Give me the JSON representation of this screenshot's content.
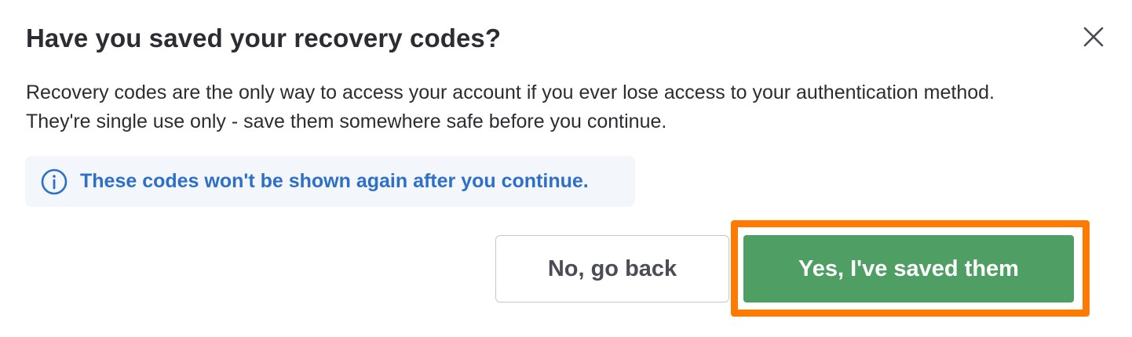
{
  "dialog": {
    "title": "Have you saved your recovery codes?",
    "close_icon": "close-icon",
    "body_line_1": "Recovery codes are the only way to access your account if you ever lose access to your authentication method.",
    "body_line_2": "They're single use only - save them somewhere safe before you continue.",
    "info": {
      "icon": "info-icon",
      "text": "These codes won't be shown again after you continue."
    },
    "buttons": {
      "back_label": "No, go back",
      "confirm_label": "Yes, I've saved them"
    },
    "colors": {
      "title_text": "#2b2d33",
      "info_text": "#2e6fc9",
      "info_background": "#f3f6fb",
      "primary_button": "#4f9f65",
      "highlight": "#ff7a00"
    }
  }
}
